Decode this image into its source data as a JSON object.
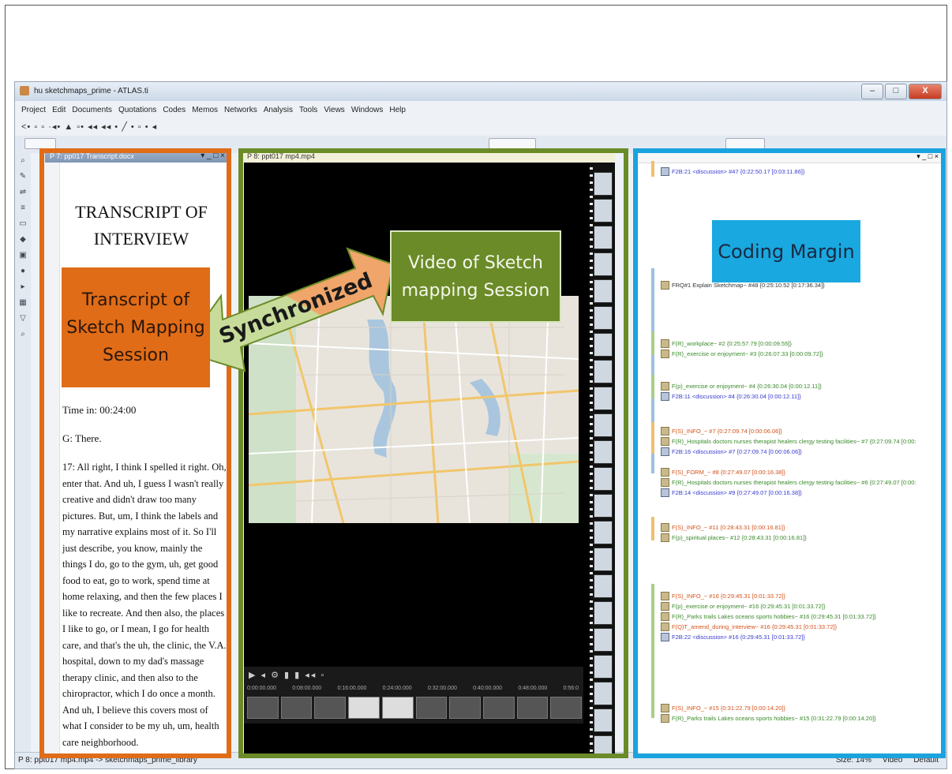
{
  "window": {
    "title": "hu sketchmaps_prime - ATLAS.ti",
    "buttons": {
      "minimize": "–",
      "maximize": "□",
      "close": "X"
    }
  },
  "menu": [
    "Project",
    "Edit",
    "Documents",
    "Quotations",
    "Codes",
    "Memos",
    "Networks",
    "Analysis",
    "Tools",
    "Views",
    "Windows",
    "Help"
  ],
  "toolbar": {
    "glyphs": "<• ▫ ▫ ·◂• ▲ ▫• ◂◂ ◂◂ • ╱ • ▫ • ◂"
  },
  "transcript_panel": {
    "header": "P 7: pp017 Transcript.docx",
    "title_line1": "TRANSCRIPT OF",
    "title_line2": "INTERVIEW",
    "time_line": "Time in:  00:24:00",
    "g_line": "G: There.",
    "paragraph": "17:  All right, I think I spelled it right. Oh, enter that.  And uh, I guess I wasn't really creative and didn't draw too many pictures. But, um, I think the labels and my narrative explains most of it. So I'll just describe, you know, mainly the things I do, go to the gym, uh, get good food to eat, go to work, spend time at home relaxing, and then the few places I like to recreate. And then also, the places I like to go, or I mean, I go for health care, and that's the uh, the clinic, the V.A. hospital, down to my dad's massage therapy clinic, and then also to the chiropractor, which I do once a month. And uh, I believe this covers most of what I consider to be my uh, um, health care neighborhood."
  },
  "video_panel": {
    "header": "P 8: ppt017 mp4.mp4",
    "timecodes": [
      "0:00:00.000",
      "0:08:00.000",
      "0:16:00.000",
      "0:24:00.000",
      "0:32:00.000",
      "0:40:00.000",
      "0:48:00.000",
      "0:56:0"
    ]
  },
  "coding_margin": {
    "entries": [
      {
        "text": "F2B:21 <discussion> #47 {0:22:50.17 [0:03:11.86]}",
        "color": "blue"
      },
      {
        "text": "FRQ#1 Explain Sketchmap~ #48 {0:25:10.52 [0:17:36.34]}",
        "color": "black"
      },
      {
        "text": "F(R)_workplace~ #2 {0:25:57.79 [0:00:09.55]}",
        "color": "green"
      },
      {
        "text": "F(R)_exercise or enjoyment~ #3 {0:26:07.33 [0:00:09.72]}",
        "color": "green"
      },
      {
        "text": "F(p)_exercise or enjoyment~ #4 {0:26:30.04 [0:00:12.11]}",
        "color": "green"
      },
      {
        "text": "F2B:11 <discussion> #4 {0:26:30.04 [0:00:12.11]}",
        "color": "blue"
      },
      {
        "text": "F(S)_INFO_~ #7 {0:27:09.74 [0:00:06.06]}",
        "color": "orange"
      },
      {
        "text": "F(R)_Hospitals doctors nurses therapist healers clergy testing facilities~ #7 {0:27:09.74 [0:00:",
        "color": "green"
      },
      {
        "text": "F2B:16 <discussion> #7 {0:27:09.74 [0:00:06.06]}",
        "color": "blue"
      },
      {
        "text": "F(S)_FORM_~ #8 {0:27:49.07 [0:00:16.38]}",
        "color": "orange"
      },
      {
        "text": "F(R)_Hospitals doctors nurses therapist healers clergy testing facilities~ #6 {0:27:49.07 [0:00:",
        "color": "green"
      },
      {
        "text": "F2B:14 <discussion> #9 {0:27:49.07 [0:00:16.38]}",
        "color": "blue"
      },
      {
        "text": "F(S)_INFO_~ #11 {0:28:43.31 [0:00:16.81]}",
        "color": "orange"
      },
      {
        "text": "F(p)_spiritual places~ #12 {0:28:43.31 [0:00:16.81]}",
        "color": "green"
      },
      {
        "text": "F(S)_INFO_~ #16 {0:29:45.31 [0:01:33.72]}",
        "color": "orange"
      },
      {
        "text": "F(p)_exercise or enjoyment~ #16 {0:29:45.31 [0:01:33.72]}",
        "color": "green"
      },
      {
        "text": "F(R)_Parks trails Lakes oceans sports hobbies~ #16 {0:29:45.31 [0:01:33.72]}",
        "color": "green"
      },
      {
        "text": "F(Q)T_amend_during_interview~ #16 {0:29:45.31 [0:01:33.72]}",
        "color": "orange"
      },
      {
        "text": "F2B:22 <discussion> #16 {0:29:45.31 [0:01:33.72]}",
        "color": "blue"
      },
      {
        "text": "F(S)_INFO_~ #15 {0:31:22.79 [0:00:14.20]}",
        "color": "orange"
      },
      {
        "text": "F(R)_Parks trails Lakes oceans sports hobbies~ #15 {0:31:22.79 [0:00:14.20]}",
        "color": "green"
      }
    ]
  },
  "status_bar": {
    "left": "P 8: ppt017 mp4.mp4 -> sketchmaps_prime_library",
    "size": "Size: 14%",
    "video": "Video",
    "default": "Default"
  },
  "annotations": {
    "transcript_label": "Transcript of Sketch Mapping Session",
    "video_label": "Video of Sketch mapping Session",
    "coding_label": "Coding Margin",
    "sync_label": "Synchronized",
    "colors": {
      "orange": "#e06c18",
      "green": "#6b8b28",
      "blue": "#1aa3de"
    }
  }
}
